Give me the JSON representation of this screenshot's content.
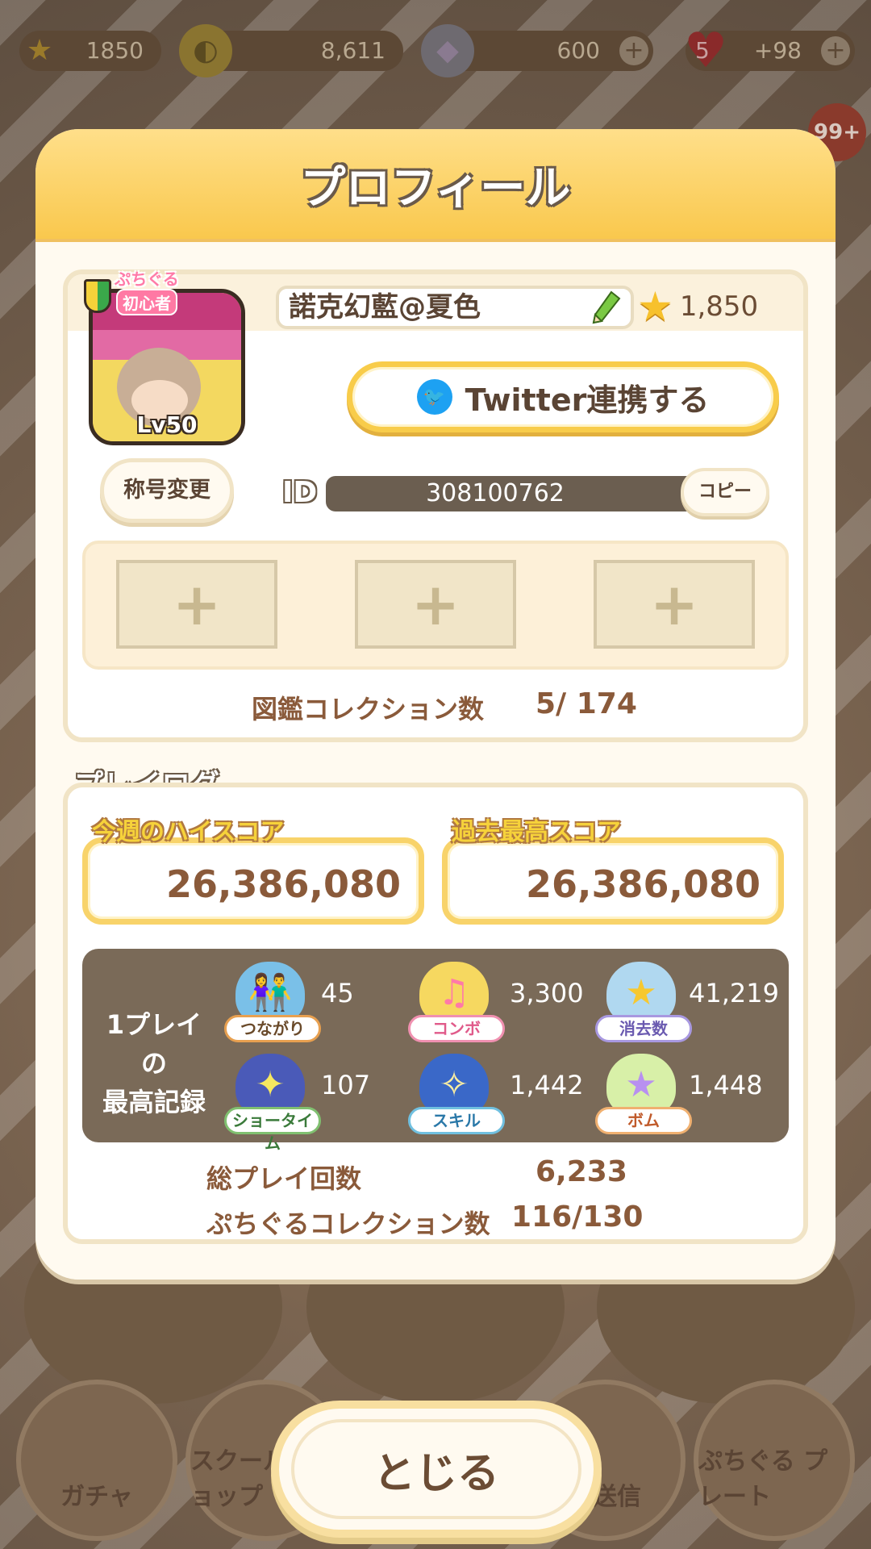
{
  "resources": {
    "star_value": "1850",
    "coins": "8,611",
    "gems": "600",
    "hearts_count": "5",
    "hearts_timer": "+98"
  },
  "notification_badge": "99+",
  "profile_modal": {
    "title": "プロフィール",
    "avatar": {
      "badge_top": "ぷちぐる",
      "badge_bottom": "初心者",
      "level": "Lv50"
    },
    "player_name": "諾克幻藍@夏色",
    "star_total": "1,850",
    "twitter_button": "Twitter連携する",
    "title_change_button": "称号変更",
    "id_label": "ID",
    "id_value": "308100762",
    "copy_button": "コピー",
    "slots": [
      "+",
      "+",
      "+"
    ],
    "collection_label": "図鑑コレクション数",
    "collection_value": "5/ 174"
  },
  "play_log": {
    "title": "プレイログ",
    "weekly_high_label": "今週のハイスコア",
    "weekly_high_value": "26,386,080",
    "best_label": "過去最高スコア",
    "best_value": "26,386,080",
    "records_title_line1": "1プレイの",
    "records_title_line2": "最高記録",
    "records": [
      {
        "label": "つながり",
        "value": "45",
        "icon": "couple-icon"
      },
      {
        "label": "コンボ",
        "value": "3,300",
        "icon": "music-note-icon"
      },
      {
        "label": "消去数",
        "value": "41,219",
        "icon": "stars-icon"
      },
      {
        "label": "ショータイム",
        "value": "107",
        "icon": "spotlight-icon"
      },
      {
        "label": "スキル",
        "value": "1,442",
        "icon": "sparkle-icon"
      },
      {
        "label": "ボム",
        "value": "1,448",
        "icon": "star-bomb-icon"
      }
    ],
    "total_plays_label": "総プレイ回数",
    "total_plays_value": "6,233",
    "puchiguru_collection_label": "ぷちぐるコレクション数",
    "puchiguru_collection_value": "116/130"
  },
  "bottom_nav": [
    "ガチャ",
    "スクール\nショップ",
    "ト送信",
    "ぷちぐる\nプレート"
  ],
  "close_button": "とじる",
  "colors": {
    "header_yellow": "#f9c84d",
    "panel_border": "#f1e4c6",
    "text_brown": "#8a5a3a",
    "twitter_blue": "#1da1f2"
  }
}
